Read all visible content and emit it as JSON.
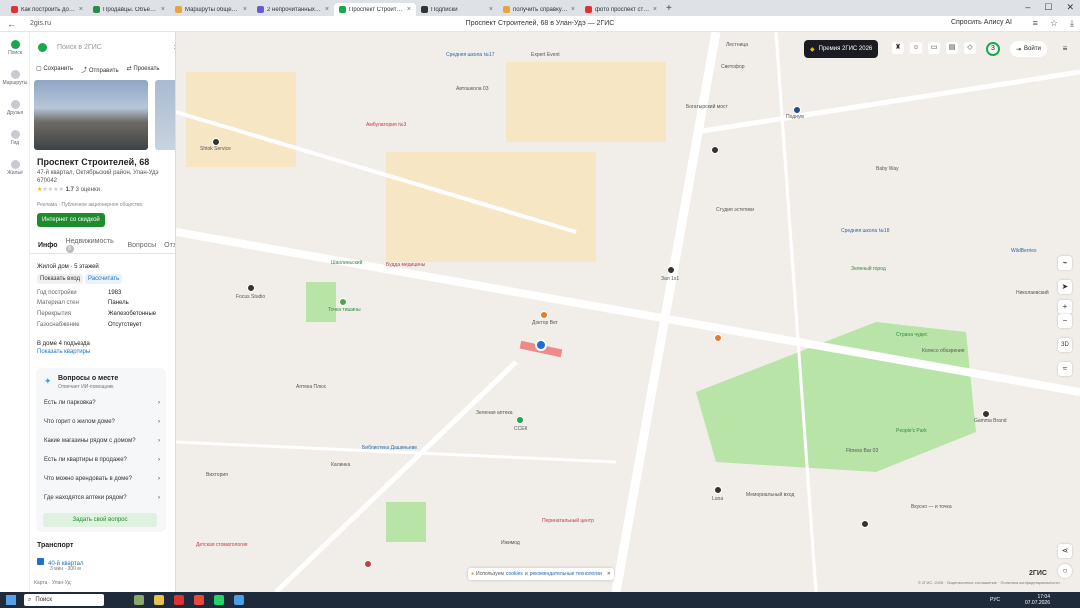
{
  "browser": {
    "tabs": [
      {
        "label": "Как построить дом в ипот",
        "color": "#d33"
      },
      {
        "label": "Продавцы. Объекты: Гом",
        "color": "#2a8c4a"
      },
      {
        "label": "Маршруты общественно",
        "color": "#e8a33c"
      },
      {
        "label": "2 непрочитанных чата",
        "color": "#6a5acd"
      },
      {
        "label": "Проспект Строителей",
        "color": "#19a84b"
      },
      {
        "label": "Подписки",
        "color": "#333"
      },
      {
        "label": "получить справку о зарп",
        "color": "#e8a33c"
      },
      {
        "label": "фото проспект строител",
        "color": "#d33"
      }
    ],
    "active_tab": 4,
    "url": "2gis.ru",
    "page_title": "Проспект Строителей, 68 в Улан-Удэ — 2ГИС",
    "alice": "Спросить Алису AI"
  },
  "rail": [
    {
      "label": "Поиск"
    },
    {
      "label": "Маршруты"
    },
    {
      "label": "Друзья"
    },
    {
      "label": "Гид"
    },
    {
      "label": "Жильё"
    }
  ],
  "panel": {
    "search_placeholder": "Поиск в 2ГИС",
    "actions": {
      "save": "Сохранить",
      "send": "Отправить",
      "route": "Проехать"
    },
    "name": "Проспект Строителей, 68",
    "address": "47-й квартал, Октябрьский район, Улан-Удэ 670042",
    "rating": "1.7",
    "rating_count": "3 оценки",
    "ad": "Реклама · Публичное акционерное общество",
    "promo": "Интернет со скидкой",
    "tabs": [
      "Инфо",
      "Недвижимость",
      "Вопросы",
      "Отз"
    ],
    "tab_badge": "8",
    "building_type": "Жилой дом",
    "floors": "5 этажей",
    "show_entrance": "Показать вход",
    "calc": "Рассчитать",
    "props": [
      {
        "k": "Год постройки",
        "v": "1983"
      },
      {
        "k": "Материал стен",
        "v": "Панель"
      },
      {
        "k": "Перекрытия",
        "v": "Железобетонные"
      },
      {
        "k": "Газоснабжение",
        "v": "Отсутствует"
      }
    ],
    "entrances": "В доме 4 подъезда",
    "show_flats": "Показать квартиры",
    "qa_title": "Вопросы о месте",
    "qa_sub": "Отвечает ИИ-помощник",
    "questions": [
      "Есть ли парковка?",
      "Что горит о жилом доме?",
      "Какие магазины рядом с домом?",
      "Есть ли квартиры в продаже?",
      "Что можно арендовать в доме?",
      "Где находятся аптеки рядом?"
    ],
    "ask": "Задать свой вопрос",
    "transport": "Транспорт",
    "stop": "40-й квартал",
    "stop_sub": "3 мин · 300 м",
    "crumbs": "Карта · Улан-Уд"
  },
  "map": {
    "premium": "Премия 2ГИС 2026",
    "notif": "3",
    "login": "Войти",
    "labels": [
      {
        "t": "Средняя школа №17",
        "c": "b"
      },
      {
        "t": "Expert Event",
        "c": ""
      },
      {
        "t": "Автошкола 03",
        "c": ""
      },
      {
        "t": "Амбулатория №3",
        "c": "r"
      },
      {
        "t": "Shtok Service",
        "c": ""
      },
      {
        "t": "Лестница",
        "c": ""
      },
      {
        "t": "Светофор",
        "c": ""
      },
      {
        "t": "Богатырский мост",
        "c": ""
      },
      {
        "t": "Подиум",
        "c": ""
      },
      {
        "t": "Baby Way",
        "c": ""
      },
      {
        "t": "Студия эстетики",
        "c": ""
      },
      {
        "t": "Средняя школа №18",
        "c": "b"
      },
      {
        "t": "Зеленый город",
        "c": "g"
      },
      {
        "t": "Зал 1х1",
        "c": ""
      },
      {
        "t": "Доктор Вет",
        "c": ""
      },
      {
        "t": "Точка тишины",
        "c": "g"
      },
      {
        "t": "Focus Studio",
        "c": ""
      },
      {
        "t": "Будда медицины",
        "c": "r"
      },
      {
        "t": "Шаолиньский",
        "c": "g"
      },
      {
        "t": "Перинатальный центр",
        "c": "r"
      },
      {
        "t": "Библиотека Дашиньеве",
        "c": "b"
      },
      {
        "t": "Калинка",
        "c": ""
      },
      {
        "t": "Вихтория",
        "c": ""
      },
      {
        "t": "Fitness Bar 03",
        "c": ""
      },
      {
        "t": "Gamma Brand",
        "c": ""
      },
      {
        "t": "People's Park",
        "c": "g"
      },
      {
        "t": "Колесо обозрения",
        "c": ""
      },
      {
        "t": "Страна чудес",
        "c": "g"
      },
      {
        "t": "Николаевский",
        "c": ""
      },
      {
        "t": "WildBerries",
        "c": "b"
      },
      {
        "t": "Мемориальный вход",
        "c": ""
      },
      {
        "t": "Luna",
        "c": ""
      },
      {
        "t": "Вкусно — и точка",
        "c": ""
      },
      {
        "t": "Ижимод",
        "c": ""
      },
      {
        "t": "Зеленая аптека",
        "c": ""
      },
      {
        "t": "Аптека Плюс",
        "c": ""
      },
      {
        "t": "Детская стоматология",
        "c": "r"
      },
      {
        "t": "ССЕК",
        "c": ""
      }
    ],
    "cookie_text": "Используем",
    "cookie_link1": "cookies",
    "cookie_and": "и",
    "cookie_link2": "рекомендательные технологии",
    "logo": "2ГИС",
    "copyright": "© 2ГИС, 2026 · Лицензионное соглашение · Политика конфиденциальности"
  },
  "taskbar": {
    "search": "Поиск",
    "lang": "РУС",
    "time": "17:04",
    "date": "07.07.2026"
  }
}
